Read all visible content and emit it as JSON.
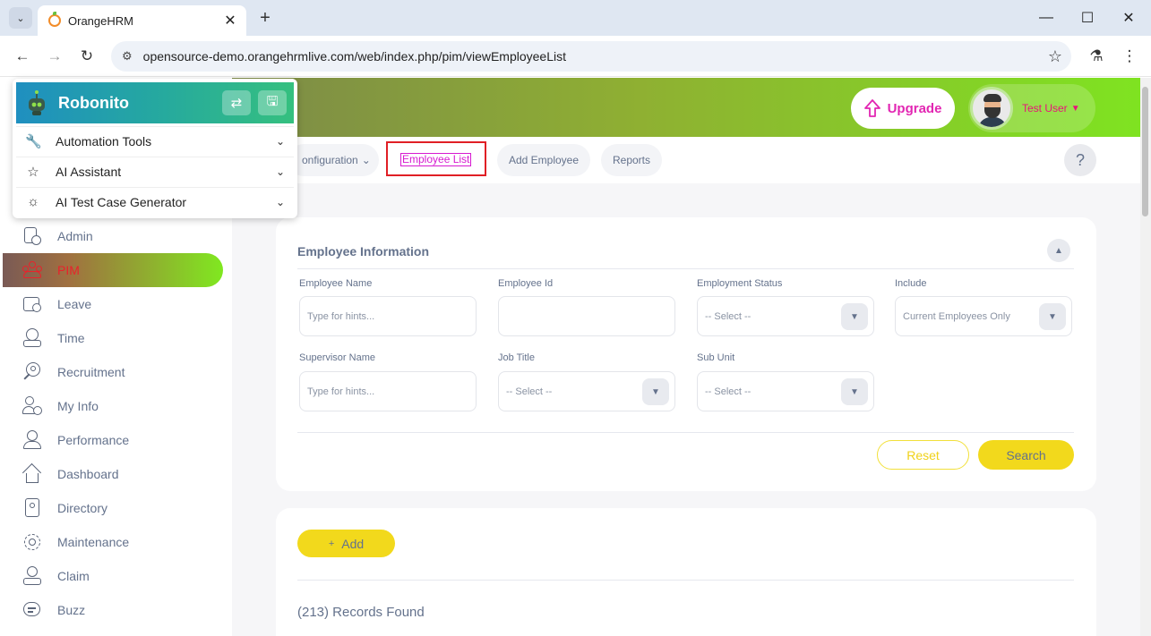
{
  "browser": {
    "tab_title": "OrangeHRM",
    "url": "opensource-demo.orangehrmlive.com/web/index.php/pim/viewEmployeeList",
    "new_tab_symbol": "+",
    "close_symbol": "✕",
    "minimize_symbol": "—",
    "maximize_symbol": "☐",
    "window_close_symbol": "✕"
  },
  "robonito": {
    "title": "Robonito",
    "items": [
      {
        "label": "Automation Tools",
        "icon": "wrench-icon"
      },
      {
        "label": "AI Assistant",
        "icon": "star-icon"
      },
      {
        "label": "AI Test Case Generator",
        "icon": "sun-icon"
      }
    ]
  },
  "header": {
    "upgrade_label": "Upgrade",
    "user_name": "Test User"
  },
  "subnav": {
    "configuration_label": "onfiguration",
    "employee_list_label": "Employee List",
    "add_employee_label": "Add Employee",
    "reports_label": "Reports",
    "help_symbol": "?"
  },
  "sidebar": {
    "items": [
      {
        "label": "Admin",
        "icon": "admin-icon",
        "active": false
      },
      {
        "label": "PIM",
        "icon": "pim-icon",
        "active": true
      },
      {
        "label": "Leave",
        "icon": "leave-icon",
        "active": false
      },
      {
        "label": "Time",
        "icon": "time-icon",
        "active": false
      },
      {
        "label": "Recruitment",
        "icon": "recruitment-icon",
        "active": false
      },
      {
        "label": "My Info",
        "icon": "my-info-icon",
        "active": false
      },
      {
        "label": "Performance",
        "icon": "performance-icon",
        "active": false
      },
      {
        "label": "Dashboard",
        "icon": "dashboard-icon",
        "active": false
      },
      {
        "label": "Directory",
        "icon": "directory-icon",
        "active": false
      },
      {
        "label": "Maintenance",
        "icon": "maintenance-icon",
        "active": false
      },
      {
        "label": "Claim",
        "icon": "claim-icon",
        "active": false
      },
      {
        "label": "Buzz",
        "icon": "buzz-icon",
        "active": false
      }
    ]
  },
  "filter": {
    "title": "Employee Information",
    "employee_name": {
      "label": "Employee Name",
      "placeholder": "Type for hints..."
    },
    "employee_id": {
      "label": "Employee Id",
      "value": ""
    },
    "employment_status": {
      "label": "Employment Status",
      "value": "-- Select --"
    },
    "include": {
      "label": "Include",
      "value": "Current Employees Only"
    },
    "supervisor_name": {
      "label": "Supervisor Name",
      "placeholder": "Type for hints..."
    },
    "job_title": {
      "label": "Job Title",
      "value": "-- Select --"
    },
    "sub_unit": {
      "label": "Sub Unit",
      "value": "-- Select --"
    },
    "reset_label": "Reset",
    "search_label": "Search"
  },
  "list": {
    "add_label": "Add",
    "add_symbol": "+",
    "records_text": "(213) Records Found"
  },
  "colors": {
    "accent_pink": "#e226b2",
    "active_text": "#e8232c",
    "button_yellow": "#f2d91c",
    "highlight_red": "#e01f25"
  }
}
